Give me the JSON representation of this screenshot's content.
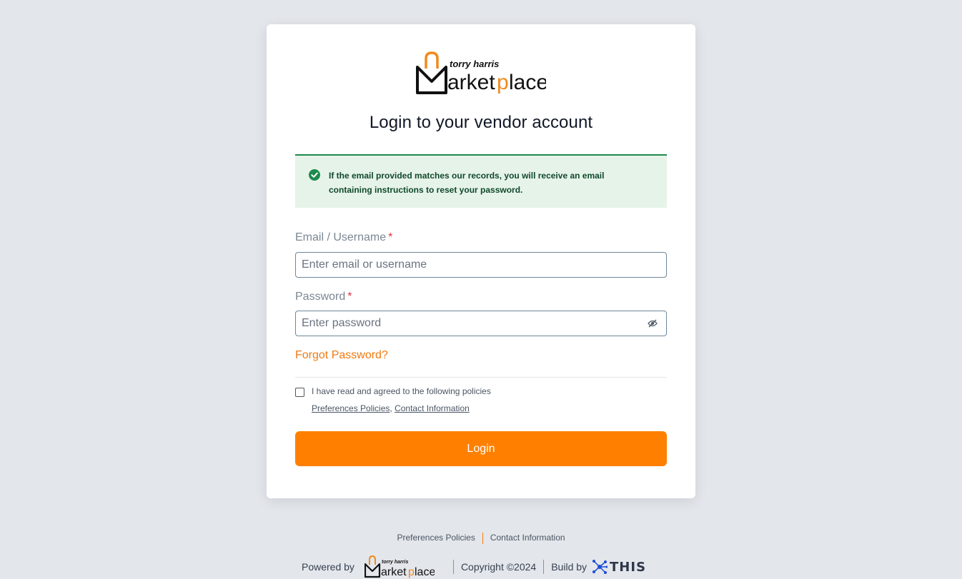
{
  "logo": {
    "brand_top": "torry harris",
    "brand_main": "Marketplace"
  },
  "login": {
    "title": "Login to your vendor account",
    "alert_message": "If the email provided matches our records, you will receive an email containing instructions to reset your password.",
    "email": {
      "label": "Email / Username",
      "required_mark": "*",
      "placeholder": "Enter email or username",
      "value": ""
    },
    "password": {
      "label": "Password",
      "required_mark": "*",
      "placeholder": "Enter password",
      "value": ""
    },
    "forgot_password": "Forgot Password?",
    "agree_text": "I have read and agreed to the following policies",
    "agree_checked": false,
    "policy_links": [
      "Preferences Policies",
      "Contact Information"
    ],
    "policy_separator": ",",
    "login_button": "Login"
  },
  "footer": {
    "links": [
      "Preferences Policies",
      "Contact Information"
    ],
    "powered_by": "Powered by",
    "copyright": "Copyright ©2024",
    "build_by": "Build by",
    "build_brand": "THIS"
  },
  "colors": {
    "accent": "#ff8000",
    "success": "#1e8a4c",
    "success_bg": "#e6f3e9",
    "required": "#e0323a",
    "page_bg": "#e3e6eb"
  }
}
